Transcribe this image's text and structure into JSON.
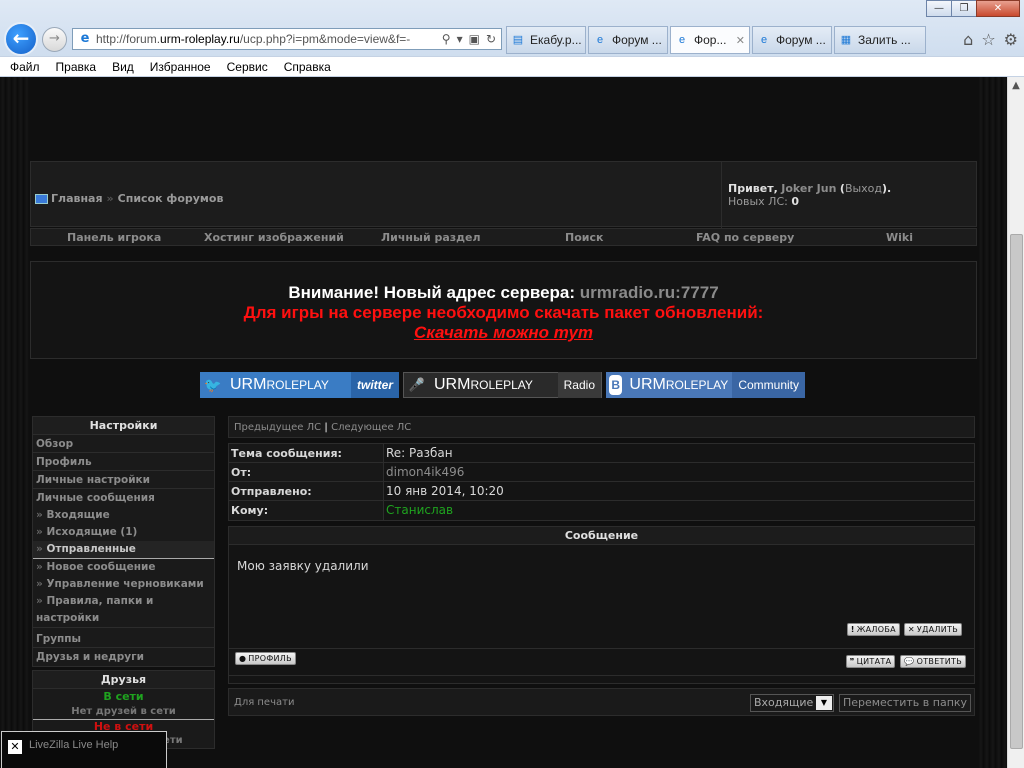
{
  "browser": {
    "url_prefix": "http://forum.",
    "url_domain": "urm-roleplay.ru",
    "url_suffix": "/ucp.php?i=pm&mode=view&f=-",
    "tabs": [
      {
        "label": "Екабу.р..."
      },
      {
        "label": "Форум ..."
      },
      {
        "label": "Фор..."
      },
      {
        "label": "Форум ..."
      },
      {
        "label": "Залить ..."
      }
    ],
    "active_tab_close": "✕",
    "menu": [
      "Файл",
      "Правка",
      "Вид",
      "Избранное",
      "Сервис",
      "Справка"
    ]
  },
  "forum": {
    "breadcrumb": {
      "home": "Главная",
      "sep": "»",
      "forums": "Список форумов"
    },
    "user": {
      "greeting": "Привет,",
      "name": "Joker Jun",
      "logout": "Выход",
      "pm_label": "Новых ЛС:",
      "pm_count": "0"
    },
    "mainmenu": [
      "Панель игрока",
      "Хостинг изображений",
      "Личный раздел",
      "Поиск",
      "FAQ по серверу",
      "Wiki"
    ],
    "notice": {
      "line1": "Внимание! Новый адрес сервера:",
      "address": "urmradio.ru:7777",
      "line2": "Для игры на сервере необходимо скачать пакет обновлений:",
      "line3": "Скачать можно тут"
    },
    "banners": [
      {
        "brand": "URM",
        "suffix": "ROLEPLAY",
        "sub": "twitter"
      },
      {
        "brand": "URM",
        "suffix": "ROLEPLAY",
        "sub": "Radio"
      },
      {
        "brand": "URM",
        "suffix": "ROLEPLAY",
        "sub": "Community"
      }
    ],
    "sidebar": {
      "settings_title": "Настройки",
      "items": [
        "Обзор",
        "Профиль",
        "Личные настройки",
        "Личные сообщения"
      ],
      "pm_sub": [
        "Входящие",
        "Исходящие (1)",
        "Отправленные",
        "Новое сообщение",
        "Управление черновиками",
        "Правила, папки и",
        "настройки"
      ],
      "bottom": [
        "Группы",
        "Друзья и недруги"
      ],
      "friends_title": "Друзья",
      "online": "В сети",
      "no_online": "Нет друзей в сети",
      "offline": "Не в сети",
      "no_offline": "Нет друзей вне сети"
    },
    "pm": {
      "prev": "Предыдущее ЛС",
      "sep": "|",
      "next": "Следующее ЛС",
      "subject_label": "Тема сообщения:",
      "subject": "Re: Разбан",
      "from_label": "От:",
      "from": "dimon4ik496",
      "sent_label": "Отправлено:",
      "sent": "10 янв 2014, 10:20",
      "to_label": "Кому:",
      "to": "Станислав",
      "message_title": "Сообщение",
      "body": "Мою заявку удалили",
      "btn_report": "Жалоба",
      "btn_delete": "Удалить",
      "btn_profile": "Профиль",
      "btn_quote": "Цитата",
      "btn_reply": "Ответить",
      "print": "Для печати",
      "folder_select": "Входящие",
      "move_button": "Переместить в папку"
    }
  },
  "livezilla": {
    "label": "LiveZilla Live Help"
  }
}
